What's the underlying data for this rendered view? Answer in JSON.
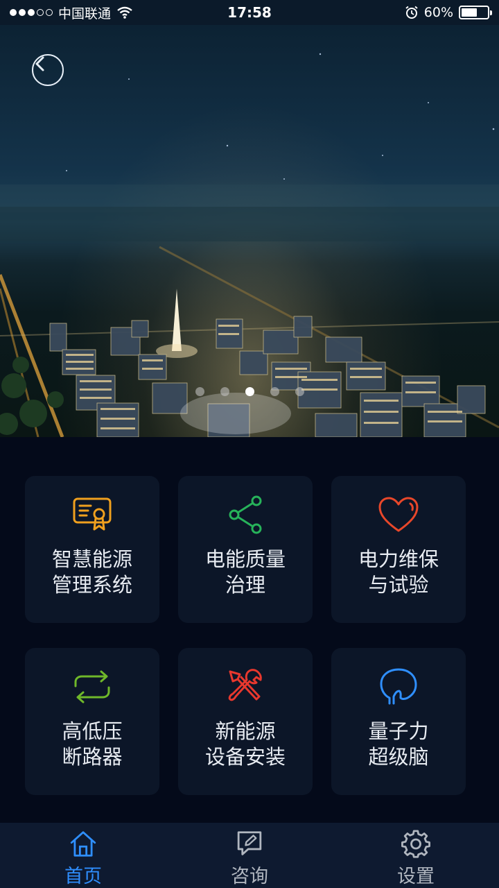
{
  "status_bar": {
    "carrier": "中国联通",
    "time": "17:58",
    "battery_percent": "60%",
    "battery_level": 0.6,
    "signal_icon": "signal-dots",
    "wifi_icon": "wifi-icon",
    "alarm_icon": "alarm-icon"
  },
  "hero": {
    "back_icon": "chevron-left-icon",
    "carousel": {
      "total": 5,
      "active_index": 2
    }
  },
  "tiles": [
    {
      "line1": "智慧能源",
      "line2": "管理系统",
      "icon": "certificate-icon",
      "color": "#f0a01e"
    },
    {
      "line1": "电能质量",
      "line2": "治理",
      "icon": "share-icon",
      "color": "#27b35a"
    },
    {
      "line1": "电力维保",
      "line2": "与试验",
      "icon": "heart-icon",
      "color": "#e8472a"
    },
    {
      "line1": "高低压",
      "line2": "断路器",
      "icon": "refresh-arrows-icon",
      "color": "#6fb82a"
    },
    {
      "line1": "新能源",
      "line2": "设备安装",
      "icon": "tools-icon",
      "color": "#e8382e"
    },
    {
      "line1": "量子力",
      "line2": "超级脑",
      "icon": "head-icon",
      "color": "#2f8fff"
    }
  ],
  "tabbar": {
    "active_color": "#2f8fff",
    "inactive_color": "#b0b6bf",
    "tabs": [
      {
        "label": "首页",
        "icon": "home-icon",
        "active": true
      },
      {
        "label": "咨询",
        "icon": "chat-edit-icon",
        "active": false
      },
      {
        "label": "设置",
        "icon": "gear-icon",
        "active": false
      }
    ]
  }
}
